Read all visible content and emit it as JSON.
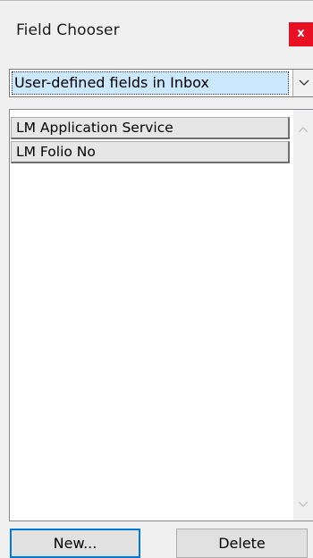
{
  "window": {
    "title": "Field Chooser",
    "close_label": "x"
  },
  "field_set": {
    "selected": "User-defined fields in Inbox"
  },
  "fields": [
    {
      "label": "LM Application Service"
    },
    {
      "label": "LM Folio No"
    }
  ],
  "actions": {
    "new_label": "New...",
    "delete_label": "Delete"
  },
  "colors": {
    "close_button": "#e81123",
    "selection_highlight": "#cce8ff",
    "focus_border": "#0078d7"
  }
}
